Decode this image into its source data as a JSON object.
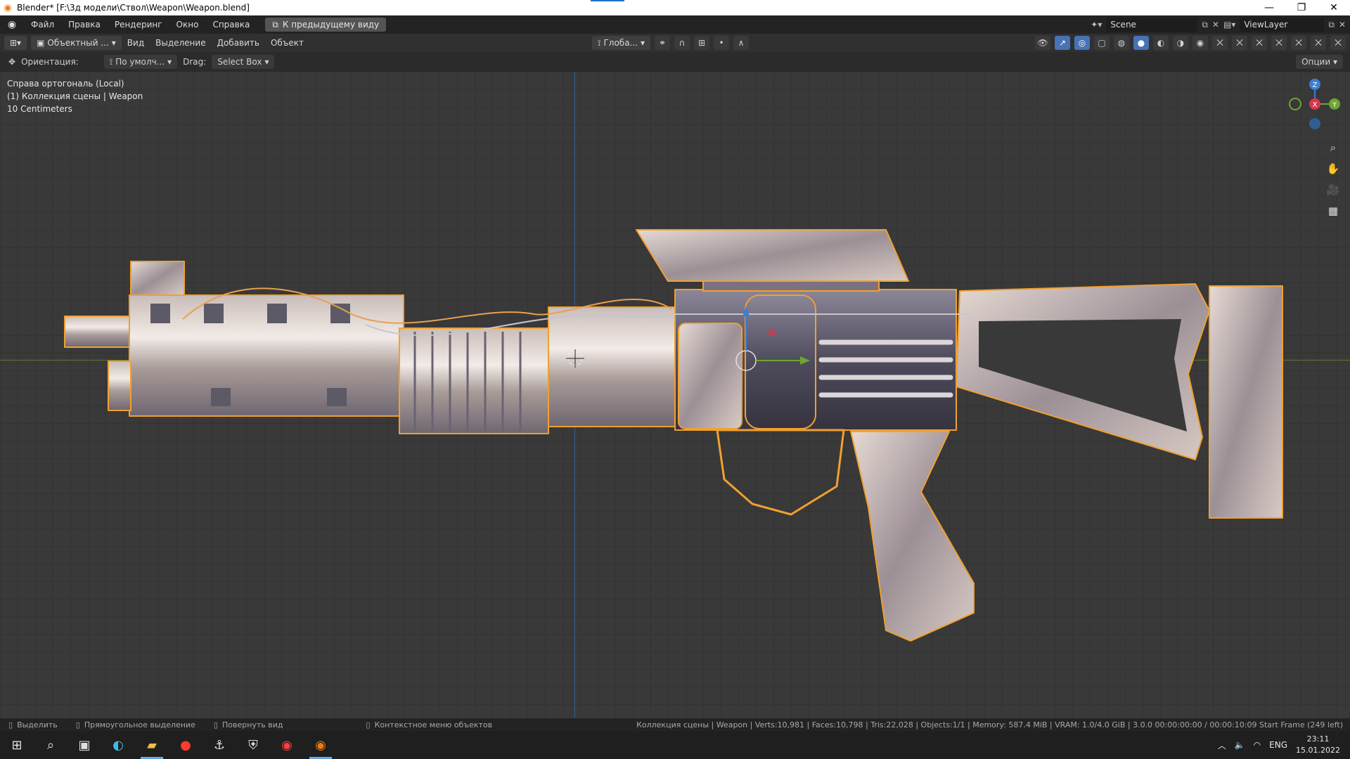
{
  "window": {
    "title": "Blender* [F:\\3д модели\\Ствол\\Weapon\\Weapon.blend]",
    "controls": [
      "minimize",
      "restore",
      "close"
    ]
  },
  "menubar": {
    "items": [
      "Файл",
      "Правка",
      "Рендеринг",
      "Окно",
      "Справка"
    ],
    "back_button": "К предыдущему виду",
    "scene": "Scene",
    "view_layer": "ViewLayer"
  },
  "header": {
    "mode": "Объектный ...",
    "menus": [
      "Вид",
      "Выделение",
      "Добавить",
      "Объект"
    ],
    "transform_orientation": "Глоба..."
  },
  "toolheader": {
    "orientation_label": "Ориентация:",
    "orientation_value": "По умолч...",
    "drag_label": "Drag:",
    "drag_value": "Select Box",
    "options": "Опции"
  },
  "viewport": {
    "view_name": "Справа ортогональ (Local)",
    "collection": "(1) Коллекция сцены | Weapon",
    "scale": "10 Centimeters",
    "gizmo_labels": {
      "z": "Z",
      "y": "Y",
      "x": "X"
    }
  },
  "statusbar": {
    "select": "Выделить",
    "box_select": "Прямоугольное выделение",
    "rotate": "Повернуть вид",
    "context": "Контекстное меню объектов",
    "stats": "Коллекция сцены | Weapon | Verts:10,981 | Faces:10,798 | Tris:22,028 | Objects:1/1 | Memory: 587.4 MiB | VRAM: 1.0/4.0 GiB | 3.0.0   00:00:00:00 / 00:00:10:09  Start Frame (249 left)"
  },
  "taskbar": {
    "lang": "ENG",
    "time": "23:11",
    "date": "15.01.2022"
  },
  "colors": {
    "selection_outline": "#f0a030",
    "axis_x": "#d9364a",
    "axis_y": "#6fa530",
    "axis_z": "#3b7ed6"
  }
}
